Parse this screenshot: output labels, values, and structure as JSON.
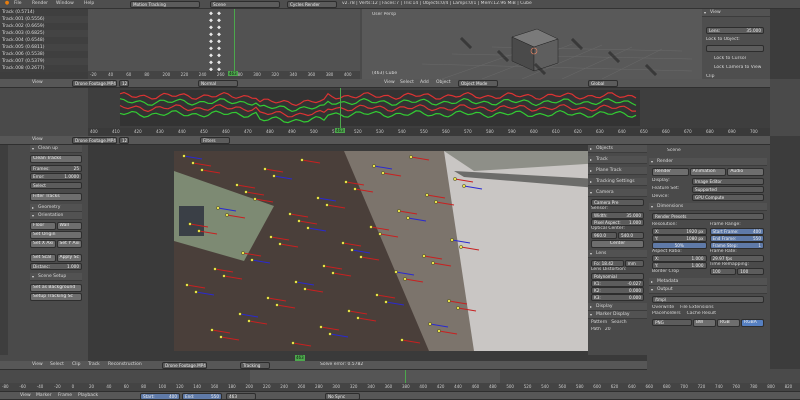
{
  "top_header": {
    "menus": [
      "File",
      "Render",
      "Window",
      "Help"
    ],
    "layout": "Motion Tracking",
    "scene": "Scene",
    "engine": "Cycles Render",
    "stats": "v2.78 | Verts:12 | Faces:7 | Tris:14 | Objects:0/4 | Lamps:0/1 | Mem:12.96 MiB | Cube"
  },
  "dopesheet": {
    "tracks": [
      "Track (0.5714)",
      "Track.001 (0.5556)",
      "Track.002 (0.6659)",
      "Track.003 (0.6825)",
      "Track.004 (0.6548)",
      "Track.005 (0.6811)",
      "Track.006 (0.5538)",
      "Track.007 (0.5379)",
      "Track.008 (0.2677)"
    ],
    "ticks": [
      "-20",
      "40",
      "60",
      "80",
      "200",
      "220",
      "240",
      "260",
      "280",
      "300",
      "320",
      "340",
      "360",
      "380",
      "400",
      "420",
      "440",
      "460",
      "480",
      "500",
      "520",
      "540",
      "560",
      "580",
      "600",
      "620",
      "640",
      "660",
      "680",
      "700",
      "720",
      "740",
      "760",
      "780",
      "800",
      "820",
      "840",
      "860",
      "880"
    ],
    "frame": "463"
  },
  "viewport3d": {
    "label": "User Persp",
    "object_label": "(463) Cube",
    "menus": [
      "View",
      "Select",
      "Add",
      "Object"
    ],
    "mode": "Object Mode",
    "orientation": "Global"
  },
  "view_panel": {
    "title": "View",
    "lens_label": "Lens:",
    "lens_value": "35.000",
    "lock_object": "Lock to Object:",
    "lock_cursor": "Lock to Cursor",
    "lock_camera": "Lock Camera to View",
    "clip": "Clip"
  },
  "graph": {
    "menus": [
      "View"
    ],
    "clip": "Drone Footage.MP4",
    "clip_num": "12",
    "normal_label": "Normal",
    "frame": "463",
    "ticks": [
      "400",
      "410",
      "420",
      "430",
      "440",
      "450",
      "460",
      "470",
      "480",
      "490",
      "500",
      "510",
      "520",
      "530",
      "540",
      "550",
      "560",
      "570",
      "580",
      "590",
      "600",
      "610",
      "620",
      "630",
      "640",
      "650",
      "660",
      "670",
      "680",
      "690",
      "700"
    ]
  },
  "clip_editor": {
    "view_label": "View",
    "clip": "Drone Footage.MP4",
    "clip_num": "12",
    "filters": "Filters",
    "frame": "463",
    "menus": [
      "View",
      "Select",
      "Clip",
      "Track",
      "Reconstruction"
    ],
    "tracking": "Tracking",
    "solve_error": "Solve error: 0.5782"
  },
  "tools": {
    "clean_up": "Clean up",
    "clean_tracks": "Clean Tracks",
    "frames_label": "Frames:",
    "frames_value": "25",
    "error_label": "Error:",
    "error_value": "1.0000",
    "select": "Select",
    "filter_tracks": "Filter Tracks",
    "geometry": "Geometry",
    "orientation": "Orientation",
    "floor": "Floor",
    "wall": "Wall",
    "set_origin": "Set Origin",
    "set_x_axis": "Set X Axi",
    "set_y_axis": "Set Y Axi",
    "set_scale": "Set Scal",
    "apply_scale": "Apply Sc",
    "distance_label": "Distanc:",
    "distance_value": "1.000",
    "scene_setup": "Scene Setup",
    "set_background": "Set as Background",
    "setup_tracking": "Setup Tracking Sc"
  },
  "clip_props": {
    "objects": "Objects",
    "track": "Track",
    "plane_track": "Plane Track",
    "tracking_settings": "Tracking Settings",
    "camera": "Camera",
    "camera_preset": "Camera Pre",
    "sensor": "Sensor:",
    "width_label": "Width:",
    "width_value": "35.000",
    "pixel_aspect_label": "Pixel Aspect:",
    "pixel_aspect_value": "1.000",
    "optical_center": "Optical Center:",
    "oc_x": "960.0",
    "oc_y": "540.0",
    "center": "Center",
    "lens": "Lens",
    "focal_label": "Fo:",
    "focal_value": "18.42",
    "focal_unit": "mm",
    "lens_distortion": "Lens Distortion:",
    "distortion_model": "Polynomial",
    "k1_label": "K1:",
    "k1_value": "-0.027",
    "k2_label": "K2:",
    "k2_value": "0.000",
    "k3_label": "K3:",
    "k3_value": "0.000",
    "display": "Display",
    "marker_display": "Marker Display",
    "pattern": "Pattern",
    "search": "Search",
    "path": "Path",
    "path_value": "20"
  },
  "render_props": {
    "scene": "Scene",
    "render": "Render",
    "render_btn": "Render",
    "animation_btn": "Animation",
    "audio_btn": "Audio",
    "display_label": "Display:",
    "display_value": "Image Editor",
    "feature_set_label": "Feature Set:",
    "feature_set_value": "Supported",
    "device_label": "Device:",
    "device_value": "GPU Compute",
    "dimensions": "Dimensions",
    "presets": "Render Presets",
    "resolution": "Resolution:",
    "res_x_label": "X:",
    "res_x": "1920 px",
    "res_y_label": "Y:",
    "res_y": "1080 px",
    "res_pct": "50%",
    "aspect_ratio": "Aspect Ratio:",
    "asp_x_label": "X:",
    "asp_x": "1.000",
    "asp_y_label": "Y:",
    "asp_y": "1.000",
    "border": "Border",
    "crop": "Crop",
    "frame_range": "Frame Range:",
    "start_label": "Start Frame:",
    "start_value": "400",
    "end_label": "End Frame:",
    "end_value": "550",
    "step_label": "Frame Step:",
    "step_value": "1",
    "frame_rate": "Frame Rate:",
    "fps_value": "29.97 fps",
    "time_remapping": "Time Remapping:",
    "remap_old": "100",
    "remap_new": "100",
    "metadata": "Metadata",
    "output": "Output",
    "output_path": "/tmp\\",
    "overwrite": "Overwrite",
    "file_extensions": "File Extensions",
    "placeholders": "Placeholders",
    "cache_result": "Cache Result",
    "format": "PNG",
    "bw": "BW",
    "rgb": "RGB",
    "rgba": "RGBA"
  },
  "timeline": {
    "menus": [
      "View",
      "Marker",
      "Frame",
      "Playback"
    ],
    "start_label": "Start:",
    "start_value": "400",
    "end_label": "End:",
    "end_value": "550",
    "frame_value": "463",
    "sync": "No Sync",
    "ticks": [
      "-80",
      "-60",
      "-40",
      "-20",
      "0",
      "20",
      "40",
      "60",
      "80",
      "100",
      "120",
      "140",
      "160",
      "180",
      "200",
      "220",
      "240",
      "260",
      "280",
      "300",
      "320",
      "340",
      "360",
      "380",
      "400",
      "420",
      "440",
      "460",
      "480",
      "500",
      "520",
      "540",
      "560",
      "580",
      "600",
      "620",
      "640",
      "660",
      "680",
      "700",
      "720",
      "740",
      "760",
      "780",
      "800",
      "820"
    ],
    "frame_marker": "463"
  }
}
